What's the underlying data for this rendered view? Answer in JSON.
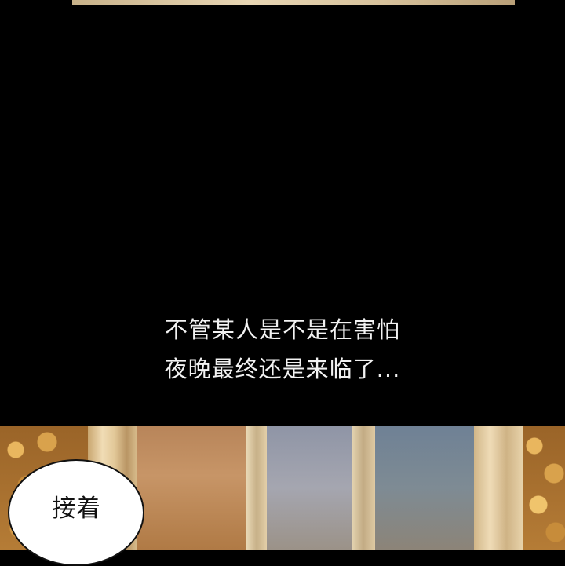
{
  "narration": {
    "line1": "不管某人是不是在害怕",
    "line2": "夜晚最终还是来临了..."
  },
  "bubble": {
    "text": "接着"
  }
}
